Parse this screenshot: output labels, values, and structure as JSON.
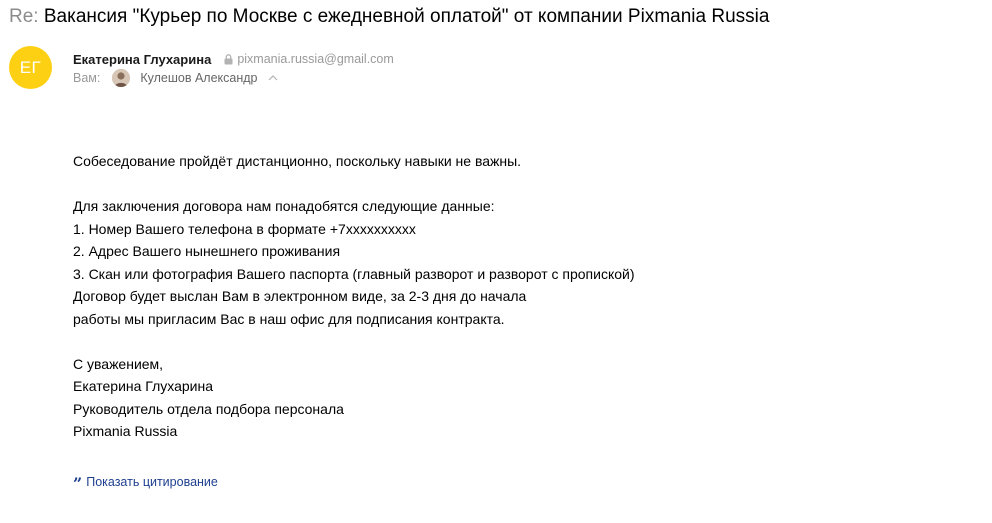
{
  "subject": {
    "prefix": "Re:",
    "title": "Вакансия \"Курьер по Москве с ежедневной оплатой\" от компании Pixmania Russia"
  },
  "sender": {
    "initials": "ЕГ",
    "name": "Екатерина Глухарина",
    "email": "pixmania.russia@gmail.com",
    "avatar_color": "#fdd014"
  },
  "recipients": {
    "label": "Вам:",
    "name": "Кулешов Александр"
  },
  "body": {
    "line1": "Собеседование пройдёт дистанционно, поскольку навыки не важны.",
    "line2": "Для заключения договора нам понадобятся следующие данные:",
    "item1": "1. Номер Вашего телефона в формате +7xxxxxxxxxx",
    "item2": "2. Адрес Вашего нынешнего проживания",
    "item3": "3. Скан или фотография Вашего паспорта (главный разворот и разворот с пропиской)",
    "line3": "Договор будет выслан Вам в электронном виде, за 2-3 дня до начала",
    "line4": "работы мы пригласим Вас в наш офис для подписания контракта.",
    "closing": "С уважением,",
    "sig_name": "Екатерина Глухарина",
    "sig_title": "Руководитель отдела подбора персонала",
    "sig_company": "Pixmania Russia"
  },
  "quote": {
    "icon": "quote-icon",
    "label": "Показать цитирование",
    "color": "#1e3f8f"
  }
}
